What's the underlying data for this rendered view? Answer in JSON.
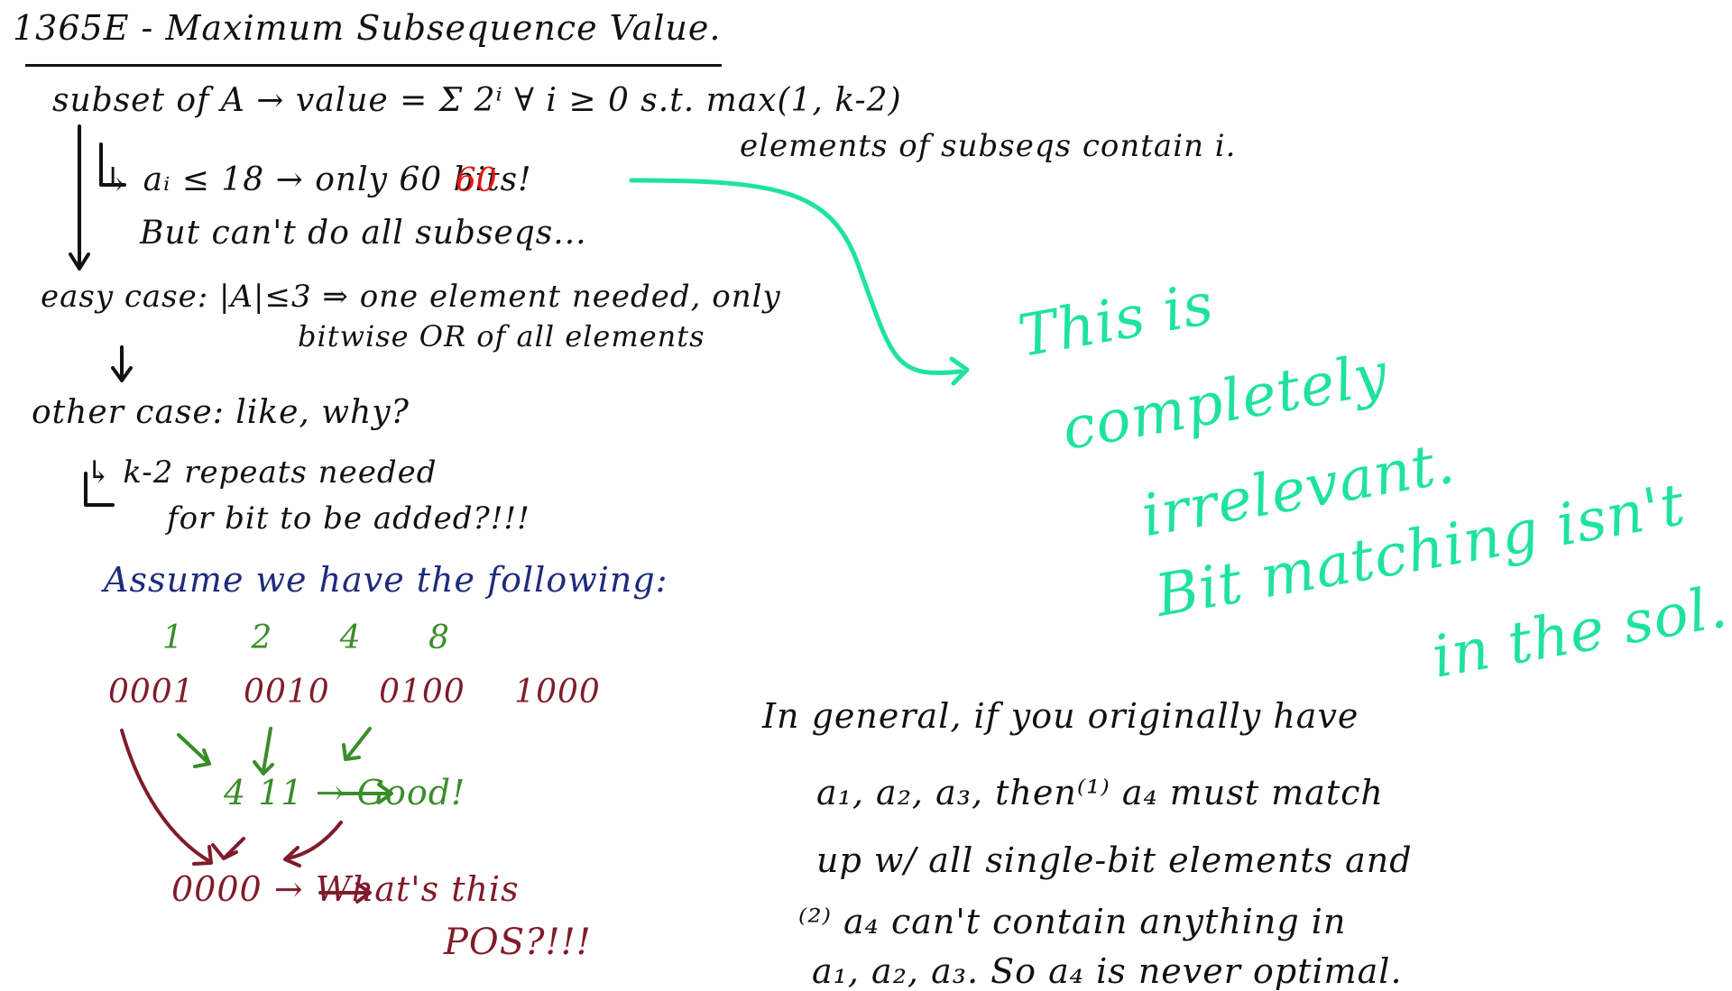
{
  "board": {
    "title": "1365E - Maximum Subsequence Value.",
    "line1": "subset of A → value = Σ 2ⁱ ∀ i ≥ 0 s.t. max(1, k-2)",
    "line1b": "elements of subseqs contain i.",
    "line2": "↳ aᵢ ≤ 18 → only 60 bits!",
    "line3": "But can't do all subseqs...",
    "line4": "easy case: |A|≤3 ⇒ one element needed, only",
    "line5": "bitwise OR of all elements",
    "line6": "other case:   like, why?",
    "line7": "↳ k-2 repeats needed",
    "line8": "for bit to be added?!!!",
    "line9": "Assume we have the following:",
    "colors": {
      "ink": "#111111",
      "blue": "#1f2b7a",
      "green": "#3a8d2a",
      "maroon": "#7f1b2a",
      "mint": "#1fe39d",
      "red": "#e81414"
    }
  },
  "example": {
    "numbers": "1 2 4 8",
    "binaries": "0001 0010 0100 1000",
    "result_or": "4 11 → Good!",
    "result_zero": "0000 → What's this",
    "result_pos": "POS?!!!"
  },
  "note": {
    "l1": "This is",
    "l2": "completely",
    "l3": "irrelevant.",
    "l4": "Bit matching isn't",
    "l5": "in the sol."
  },
  "general": {
    "g1": "In general, if you originally have",
    "g2": "a₁, a₂, a₃, then⁽¹⁾ a₄ must match",
    "g3": "up w/ all single-bit elements and",
    "g4": "⁽²⁾ a₄ can't contain anything in",
    "g5": "a₁, a₂, a₃. So a₄ is never optimal."
  },
  "icons": {
    "down_arrow": "down-arrow-icon",
    "right_arrow": "right-arrow-icon"
  }
}
